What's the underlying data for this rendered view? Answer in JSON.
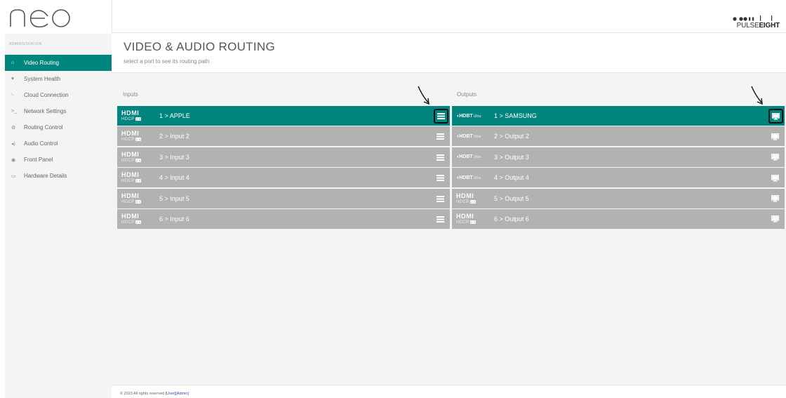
{
  "sidebar": {
    "logo_text": "neo",
    "section_label": "ADMINISTRATION",
    "items": [
      {
        "label": "Video Routing",
        "icon": "home-icon",
        "glyph": "⌂",
        "active": true
      },
      {
        "label": "System Health",
        "icon": "heart-icon",
        "glyph": "♥",
        "active": false
      },
      {
        "label": "Cloud Connection",
        "icon": "rss-icon",
        "glyph": "◝",
        "active": false
      },
      {
        "label": "Network Settings",
        "icon": "terminal-icon",
        "glyph": ">_",
        "active": false
      },
      {
        "label": "Routing Control",
        "icon": "cogs-icon",
        "glyph": "⚙",
        "active": false
      },
      {
        "label": "Audio Control",
        "icon": "volume-icon",
        "glyph": "◂)",
        "active": false
      },
      {
        "label": "Front Panel",
        "icon": "circle-dot-icon",
        "glyph": "◉",
        "active": false
      },
      {
        "label": "Hardware Details",
        "icon": "hdd-icon",
        "glyph": "▭",
        "active": false
      }
    ]
  },
  "header": {
    "brand": {
      "light": "PULSE",
      "bold": "EIGHT"
    }
  },
  "page": {
    "title": "VIDEO & AUDIO ROUTING",
    "subtitle": "select a port to see its routing path"
  },
  "inputs": {
    "label": "Inputs",
    "rows": [
      {
        "type": "hdmi",
        "logo_top": "HDMI",
        "logo_bottom": "HDCP",
        "logo_badge": "2.3",
        "label": "1 > APPLE",
        "selected": true
      },
      {
        "type": "hdmi",
        "logo_top": "HDMI",
        "logo_bottom": "HDCP",
        "logo_badge": "2.3",
        "label": "2 > Input 2",
        "selected": false
      },
      {
        "type": "hdmi",
        "logo_top": "HDMI",
        "logo_bottom": "HDCP",
        "logo_badge": "2.3",
        "label": "3 > Input 3",
        "selected": false
      },
      {
        "type": "hdmi",
        "logo_top": "HDMI",
        "logo_bottom": "HDCP",
        "logo_badge": "2.3",
        "label": "4 > Input 4",
        "selected": false
      },
      {
        "type": "hdmi",
        "logo_top": "HDMI",
        "logo_bottom": "HDCP",
        "logo_badge": "2.3",
        "label": "5 > Input 5",
        "selected": false
      },
      {
        "type": "hdmi",
        "logo_top": "HDMI",
        "logo_bottom": "HDCP",
        "logo_badge": "2.3",
        "label": "6 > Input 6",
        "selected": false
      }
    ]
  },
  "outputs": {
    "label": "Outputs",
    "rows": [
      {
        "type": "hdbt",
        "logo_top": "HDBT",
        "logo_suffix": "Ultra",
        "label": "1 > SAMSUNG",
        "selected": true
      },
      {
        "type": "hdbt",
        "logo_top": "HDBT",
        "logo_suffix": "Ultra",
        "label": "2 > Output 2",
        "selected": false
      },
      {
        "type": "hdbt",
        "logo_top": "HDBT",
        "logo_suffix": "Ultra",
        "label": "3 > Output 3",
        "selected": false
      },
      {
        "type": "hdbt",
        "logo_top": "HDBT",
        "logo_suffix": "Ultra",
        "label": "4 > Output 4",
        "selected": false
      },
      {
        "type": "hdmi",
        "logo_top": "HDMI",
        "logo_bottom": "HDCP",
        "logo_badge": "2.3",
        "label": "5 > Output 5",
        "selected": false
      },
      {
        "type": "hdmi",
        "logo_top": "HDMI",
        "logo_bottom": "HDCP",
        "logo_badge": "2.3",
        "label": "6 > Output 6",
        "selected": false
      }
    ]
  },
  "footer": {
    "copyright": "© 2023 All rights reserved",
    "user_link": "[User]",
    "admin_link": "[Admin]"
  },
  "colors": {
    "accent": "#00867f",
    "row_inactive": "#b2b2b2",
    "sidebar_bg": "#f4f4f4"
  }
}
